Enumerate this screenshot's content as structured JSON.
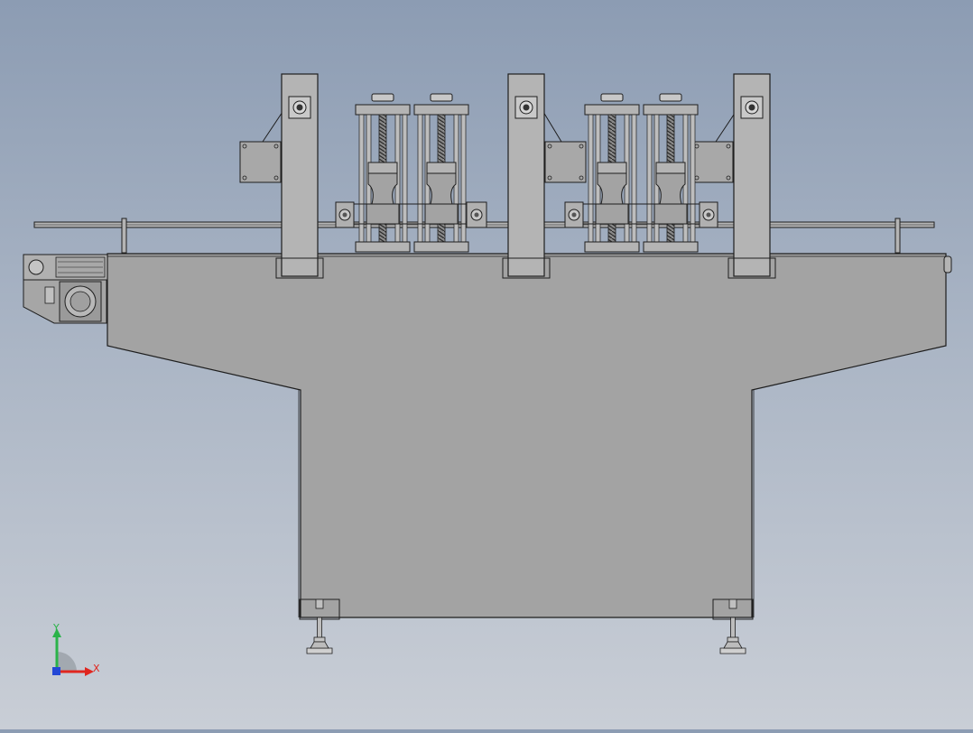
{
  "view": {
    "background_top": "#8c9cb3",
    "background_bottom": "#c9ced6",
    "part_fill": "#a3a3a3",
    "part_fill_light": "#b4b4b4",
    "edge_color": "#1e1e1e"
  },
  "machine": {
    "columns": 3,
    "filling_heads": 4,
    "leveling_feet": 2,
    "wall_brackets": 3
  },
  "triad": {
    "x_label": "X",
    "y_label": "Y",
    "x_color": "#e0261f",
    "y_color": "#2bb34a",
    "z_color": "#2448d6"
  }
}
